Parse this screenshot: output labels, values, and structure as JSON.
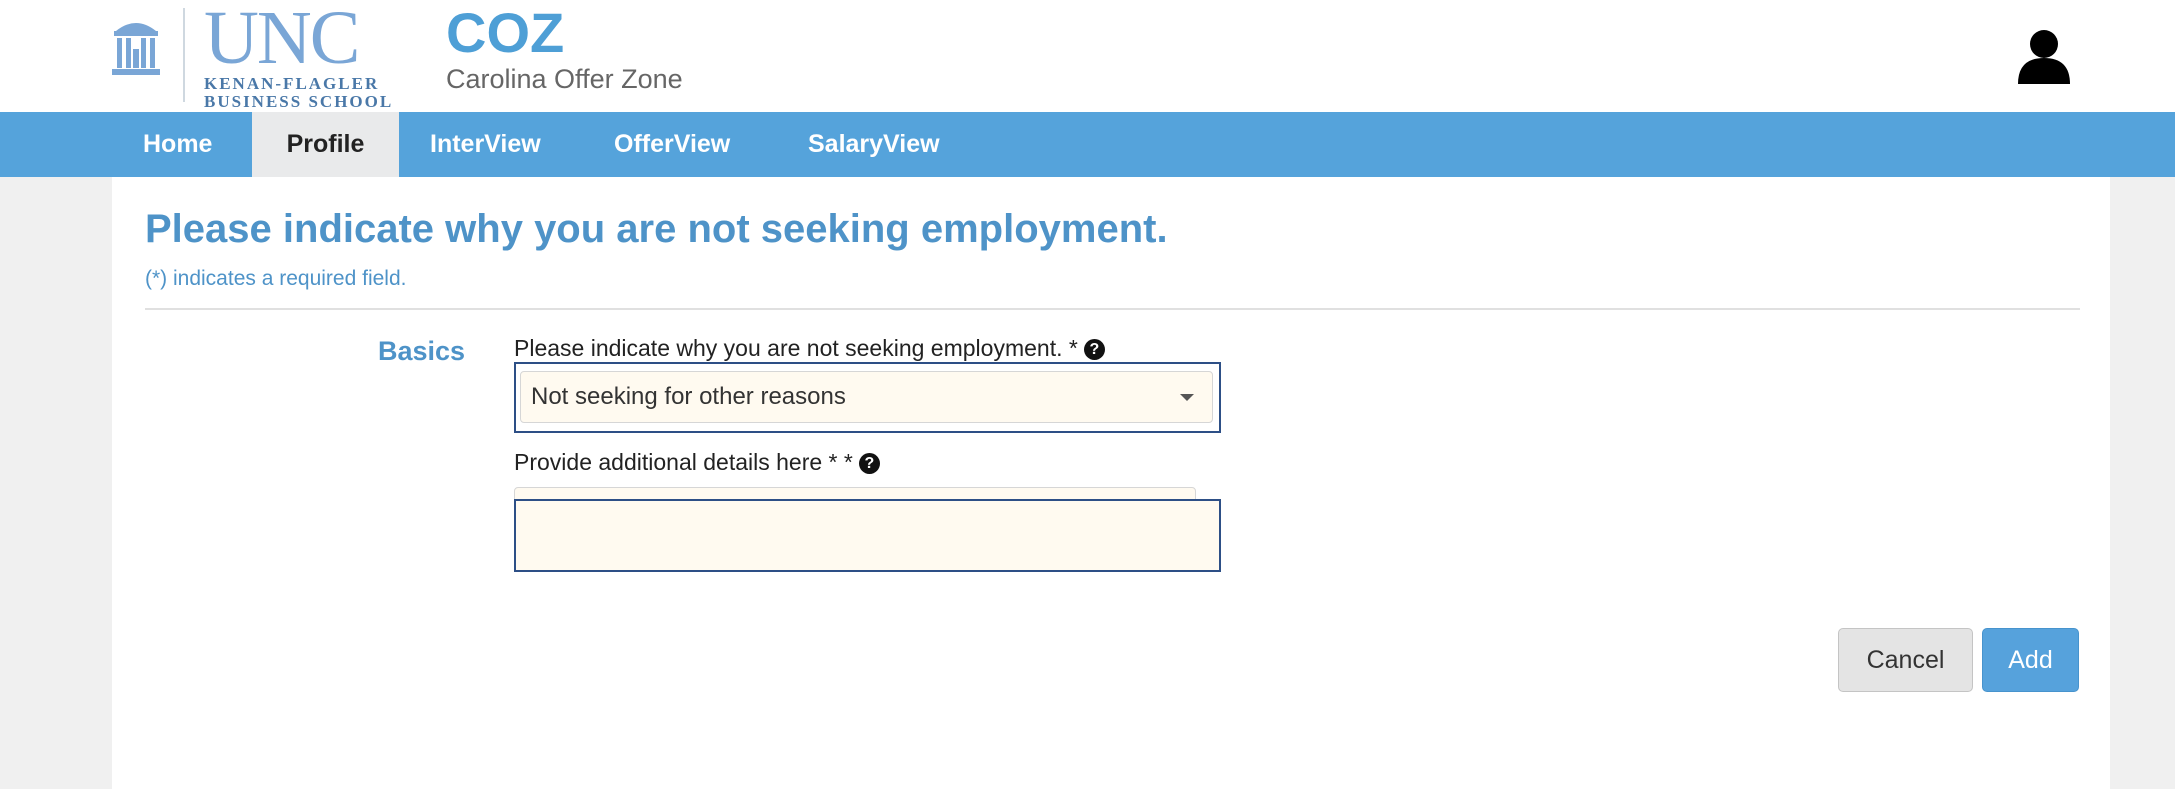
{
  "header": {
    "logo": {
      "unc": "UNC",
      "line1": "KENAN-FLAGLER",
      "line2": "BUSINESS SCHOOL",
      "icon": "old-well-icon"
    },
    "app_name": "COZ",
    "app_subtitle": "Carolina Offer Zone",
    "user_icon": "user-icon"
  },
  "nav": {
    "items": [
      {
        "label": "Home",
        "active": false
      },
      {
        "label": "Profile",
        "active": true
      },
      {
        "label": "InterView",
        "active": false
      },
      {
        "label": "OfferView",
        "active": false
      },
      {
        "label": "SalaryView",
        "active": false
      }
    ]
  },
  "form": {
    "title": "Please indicate why you are not seeking employment.",
    "required_note": "(*) indicates a required field.",
    "section_label": "Basics",
    "reason_label": "Please indicate why you are not seeking employment. *",
    "reason_value": "Not seeking for other reasons",
    "details_label": "Provide additional details here * *",
    "details_value": "",
    "help_icon": "question-circle-icon"
  },
  "actions": {
    "cancel_label": "Cancel",
    "add_label": "Add"
  },
  "colors": {
    "nav_bg": "#55a3db",
    "accent": "#4e93c8",
    "focus_border": "#2d4f86",
    "input_bg": "#fffaf0"
  }
}
